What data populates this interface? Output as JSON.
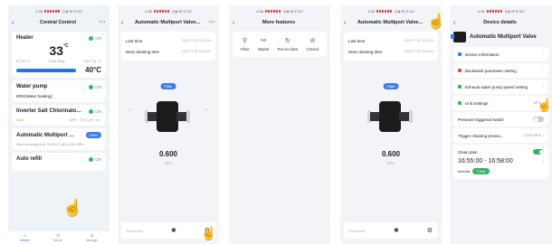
{
  "status_bar": {
    "time": "4:36",
    "right": "◎◈ ✉ ⚲ 5G"
  },
  "screen1": {
    "title": "Central Control",
    "heater": {
      "label": "Heater",
      "state": "ON",
      "temp": "33",
      "unit": "°C",
      "in_label": "IN 33 °C",
      "mode": "Heat Stay",
      "out_label": "OUT 34 °C",
      "setpoint": "40°C"
    },
    "pump": {
      "label": "Water pump",
      "state": "ON",
      "sub": "80%(Water heating)"
    },
    "chlorinator": {
      "label": "Inverter Salt Chlorinato...",
      "state": "ON",
      "sub_left": "Wait",
      "sub_right": "ORP : 729 | pH : 6.7"
    },
    "valve": {
      "label": "Automatic Multiport ...",
      "badge": "Filter",
      "sub": "Next cleaning time   2025 17:36   0.600 MPa"
    },
    "autorefill": {
      "label": "Auto refill",
      "state": "ON"
    },
    "tabs": [
      {
        "icon": "⌂",
        "label": "Device"
      },
      {
        "icon": "◷",
        "label": "Scene"
      },
      {
        "icon": "♙",
        "label": "Manage"
      }
    ]
  },
  "screen2": {
    "title": "Automatic Multiport Valve...",
    "last_time_label": "Last time",
    "last_time_value": "2025.17.36 19:29:19",
    "next_clean_label": "Next cleaning time",
    "next_clean_value": "2025.17.36 19:00:00",
    "mode_badge": "Filter",
    "pressure": "0.600",
    "unit": "MPa",
    "backwash_label": "Backwash"
  },
  "screen3": {
    "title": "More features",
    "features": [
      {
        "icon": "⚲",
        "label": "Filter"
      },
      {
        "icon": "⚯",
        "label": "Waste"
      },
      {
        "icon": "↻",
        "label": "Recirculate"
      },
      {
        "icon": "⊘",
        "label": "Closed"
      }
    ]
  },
  "screen4": {
    "title": "Automatic Multiport Valve...",
    "last_time_label": "Last time",
    "last_time_value": "2025.17.36 19:29:19",
    "next_clean_label": "Next cleaning time",
    "next_clean_value": "2025.17.36 19:00:00",
    "mode_badge": "Filter",
    "pressure": "0.600",
    "unit": "MPa",
    "backwash_label": "Backwash"
  },
  "screen5": {
    "title": "Device details",
    "device_name": "Automatic Multiport Valve",
    "items": [
      {
        "label": "Device Information",
        "value": "",
        "color": "#3b7df0"
      },
      {
        "label": "Backwash parameter setting",
        "value": "",
        "color": "#e14b4b"
      },
      {
        "label": "Exhaust water pump speed setting",
        "value": "",
        "color": "#38b36b"
      },
      {
        "label": "Unit Settings",
        "value": "MPa",
        "color": "#38b36b"
      }
    ],
    "pressure_switch_label": "Pressure triggered switch",
    "trigger_label": "Trigger cleaning pressu...",
    "trigger_value": "0.000 MPa",
    "clean_plan_label": "Clean plan",
    "plan_time": "16:55:00 - 16:58:00",
    "interval_label": "Interval",
    "interval_badge": "7 Day"
  }
}
